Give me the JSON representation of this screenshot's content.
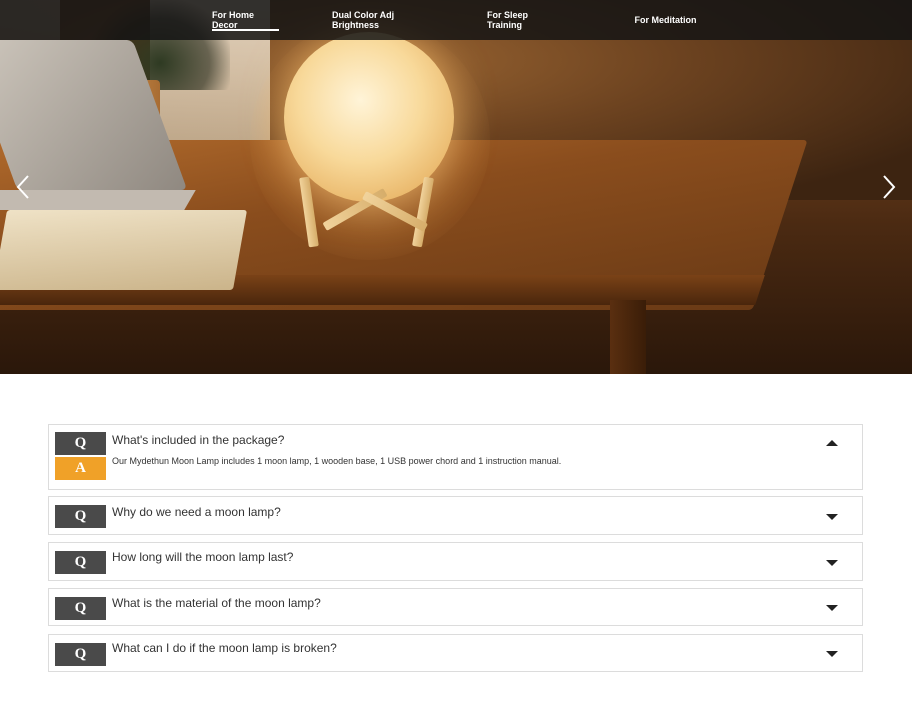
{
  "nav": {
    "tabs": [
      {
        "label": "For Home Decor",
        "active": true
      },
      {
        "label": "Dual Color Adj Brightness",
        "active": false
      },
      {
        "label": "For Sleep Training",
        "active": false
      },
      {
        "label": "For Meditation",
        "active": false
      }
    ]
  },
  "carousel": {
    "prev_icon": "chevron-left-icon",
    "next_icon": "chevron-right-icon"
  },
  "faq": {
    "q_badge": "Q",
    "a_badge": "A",
    "items": [
      {
        "question": "What's included in the package?",
        "answer": "Our Mydethun Moon Lamp includes 1 moon lamp, 1 wooden base, 1 USB power chord and 1 instruction manual.",
        "expanded": true
      },
      {
        "question": "Why do we need a moon lamp?",
        "expanded": false
      },
      {
        "question": "How long will the moon lamp last?",
        "expanded": false
      },
      {
        "question": "What is the material of the moon lamp?",
        "expanded": false
      },
      {
        "question": "What can I do if the moon lamp is broken?",
        "expanded": false
      }
    ]
  },
  "colors": {
    "nav_bg": "#141414",
    "q_badge": "#4a4a4a",
    "a_badge": "#f0a128",
    "border": "#dcdcdc"
  }
}
